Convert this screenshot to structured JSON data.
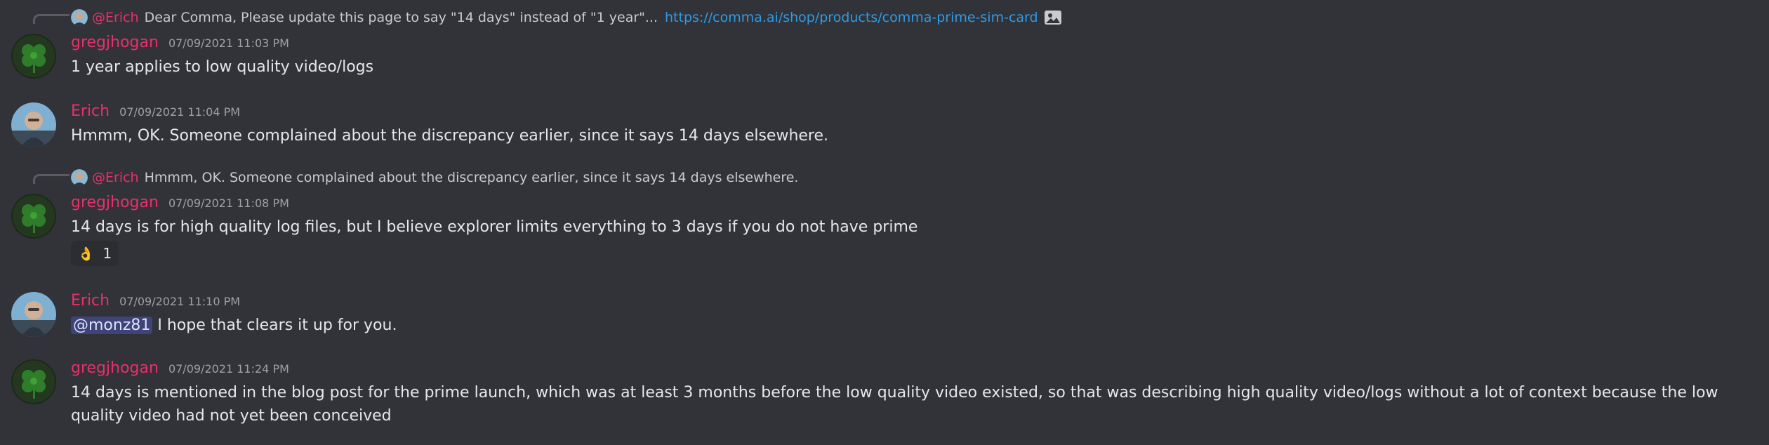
{
  "messages": [
    {
      "reply": {
        "author": "@Erich",
        "text": "Dear Comma, Please update this page to say \"14 days\" instead of \"1 year\"...",
        "link": "https://comma.ai/shop/products/comma-prime-sim-card",
        "icon": "image-icon"
      },
      "username": "gregjhogan",
      "timestamp": "07/09/2021 11:03 PM",
      "content": "1 year applies to low quality video/logs"
    },
    {
      "username": "Erich",
      "timestamp": "07/09/2021 11:04 PM",
      "content": "Hmmm, OK.  Someone complained about the discrepancy earlier, since it says 14 days elsewhere."
    },
    {
      "reply": {
        "author": "@Erich",
        "text": "Hmmm, OK. Someone complained about the discrepancy earlier, since it says 14 days elsewhere."
      },
      "username": "gregjhogan",
      "timestamp": "07/09/2021 11:08 PM",
      "content": "14 days is for high quality log files, but I believe explorer limits everything to 3 days if you do not have prime",
      "reaction": {
        "emoji": "👌",
        "count": "1"
      }
    },
    {
      "username": "Erich",
      "timestamp": "07/09/2021 11:10 PM",
      "mention": "@monz81",
      "content": " I hope that clears it up for you."
    },
    {
      "username": "gregjhogan",
      "timestamp": "07/09/2021 11:24 PM",
      "content": "14 days is mentioned in the blog post for the prime launch, which was at least 3 months before the low quality video existed, so that was describing high quality video/logs without a lot of context because the low quality video had not yet been conceived"
    }
  ],
  "colors": {
    "background": "#313338",
    "username": "#e8306a",
    "link": "#2f9be6",
    "mention_bg": "#3c4270"
  }
}
